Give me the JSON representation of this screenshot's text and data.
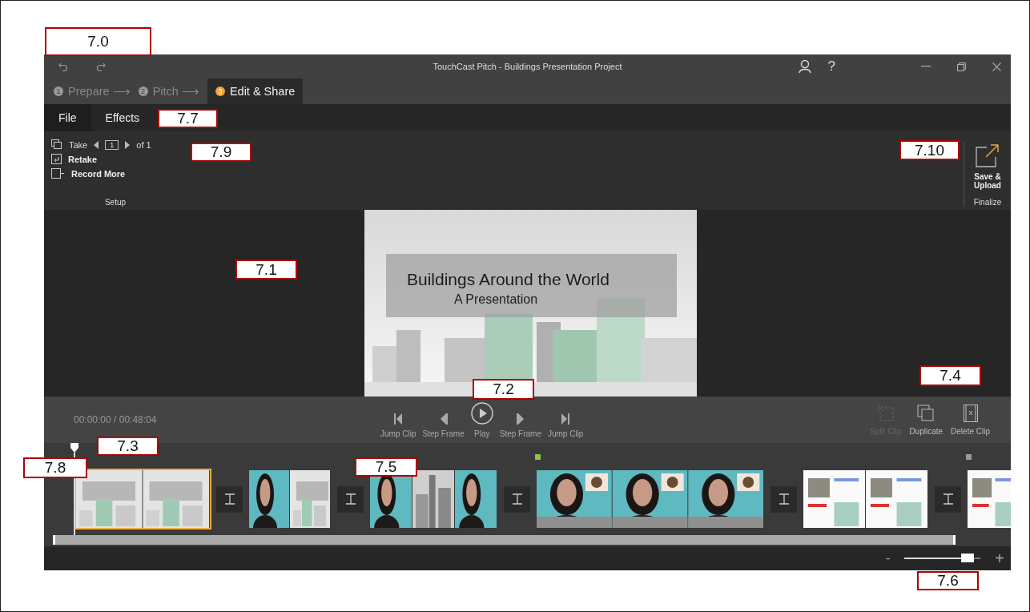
{
  "window": {
    "title": "TouchCast Pitch - Buildings Presentation Project"
  },
  "titlebar_buttons": {
    "help": "?"
  },
  "steps": [
    {
      "number": "1",
      "label": "Prepare ⟶",
      "selected": false
    },
    {
      "number": "2",
      "label": "Pitch ⟶",
      "selected": false
    },
    {
      "number": "3",
      "label": "Edit & Share",
      "selected": true
    }
  ],
  "menu": [
    {
      "label": "File",
      "kind": "backstage"
    },
    {
      "label": "Effects",
      "kind": "tab"
    }
  ],
  "ribbon": {
    "setup": {
      "take_label": "Take",
      "take_number": "1",
      "take_total": "of 1",
      "retake": "Retake",
      "record_more": "Record More",
      "group_label": "Setup"
    },
    "finalize": {
      "button": "Save & Upload",
      "group_label": "Finalize"
    }
  },
  "slide": {
    "title": "Buildings Around the World",
    "subtitle": "A Presentation"
  },
  "time": "00:00:00 / 00:48:04",
  "transport": [
    {
      "kind": "jump-back",
      "label": "Jump Clip"
    },
    {
      "kind": "step-back",
      "label": "Step Frame"
    },
    {
      "kind": "play",
      "label": "Play"
    },
    {
      "kind": "step-forward",
      "label": "Step Frame"
    },
    {
      "kind": "jump-forward",
      "label": "Jump Clip"
    }
  ],
  "clip_actions": [
    {
      "kind": "split",
      "label": "Split Clip",
      "disabled": true
    },
    {
      "kind": "duplicate",
      "label": "Duplicate",
      "disabled": false
    },
    {
      "kind": "delete",
      "label": "Delete Clip",
      "disabled": false
    }
  ],
  "clips": [
    {
      "selected": true
    },
    {
      "selected": false
    },
    {
      "selected": false
    },
    {
      "selected": false,
      "color": "#8fc34a"
    },
    {
      "selected": false
    },
    {
      "selected": false,
      "color": "#9a9a9a"
    }
  ],
  "zoom": {
    "minus": "-",
    "plus": "+",
    "level": 0.83
  },
  "callouts": [
    "7.0",
    "7.7",
    "7.9",
    "7.10",
    "7.1",
    "7.2",
    "7.4",
    "7.3",
    "7.8",
    "7.5",
    "7.6"
  ]
}
